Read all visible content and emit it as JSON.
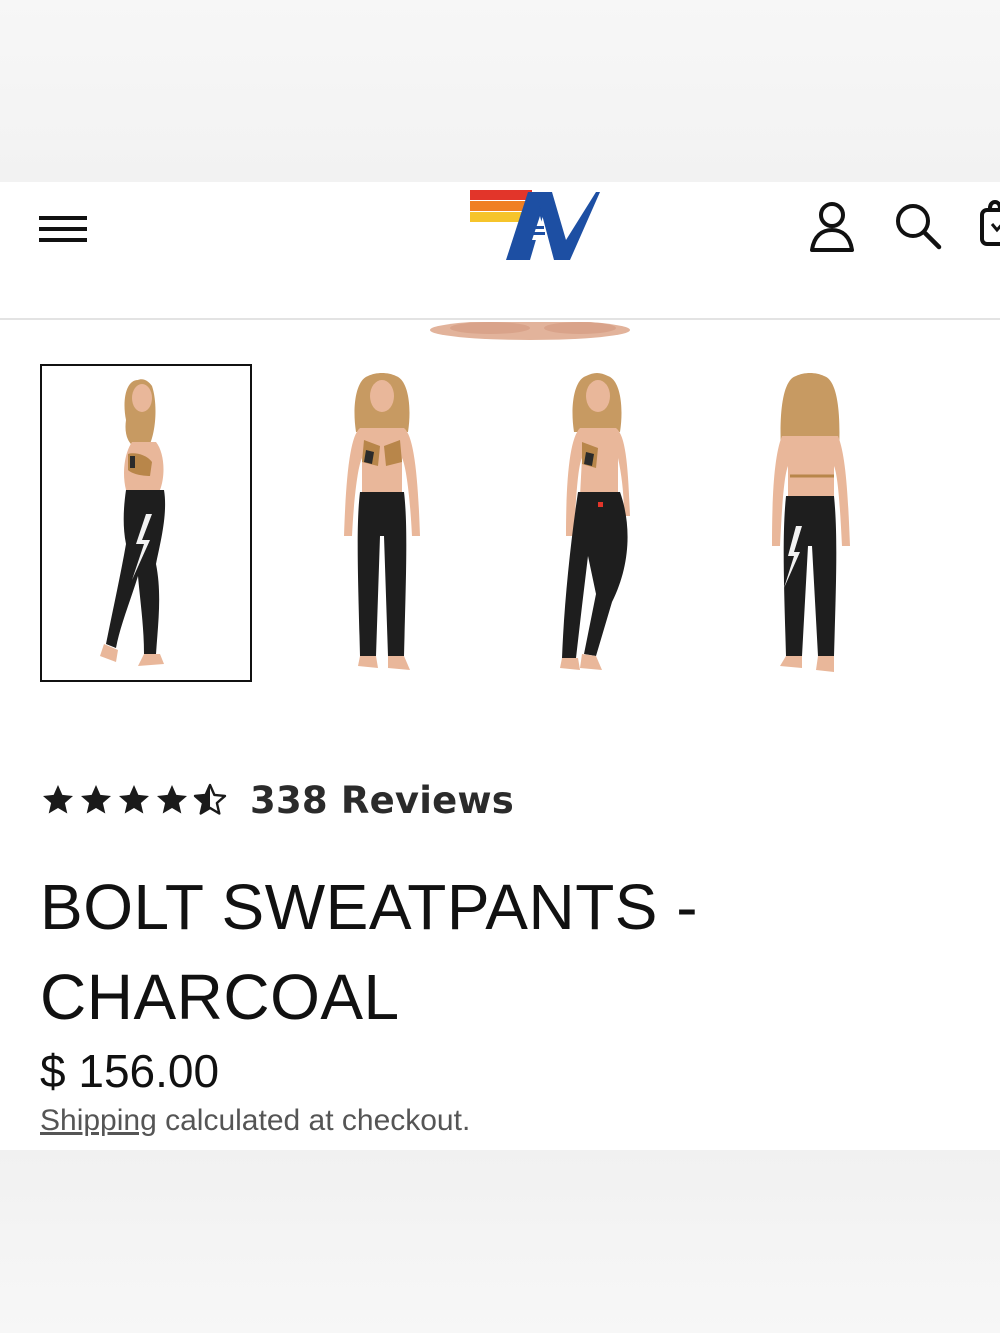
{
  "header": {
    "menu_icon": "hamburger-menu-icon",
    "logo": "aviator-nation-logo",
    "account_icon": "user-icon",
    "search_icon": "search-icon",
    "cart_icon": "cart-bag-icon"
  },
  "gallery": {
    "thumbnails": [
      {
        "name": "thumbnail-side-view",
        "selected": true
      },
      {
        "name": "thumbnail-front-view",
        "selected": false
      },
      {
        "name": "thumbnail-angle-view",
        "selected": false
      },
      {
        "name": "thumbnail-back-view",
        "selected": false
      }
    ]
  },
  "product": {
    "rating": 4.5,
    "reviews_label": "338 Reviews",
    "title_line1": "BOLT SWEATPANTS -",
    "title_line2": "CHARCOAL",
    "price": "$ 156.00",
    "shipping_link": "Shipping",
    "shipping_rest": " calculated at checkout."
  },
  "colors": {
    "logo_blue": "#1d4fa3",
    "logo_red": "#e2352a",
    "logo_orange": "#f07f22",
    "logo_yellow": "#f6c42b",
    "pants": "#1e1e1e",
    "skin": "#e9b79a"
  }
}
